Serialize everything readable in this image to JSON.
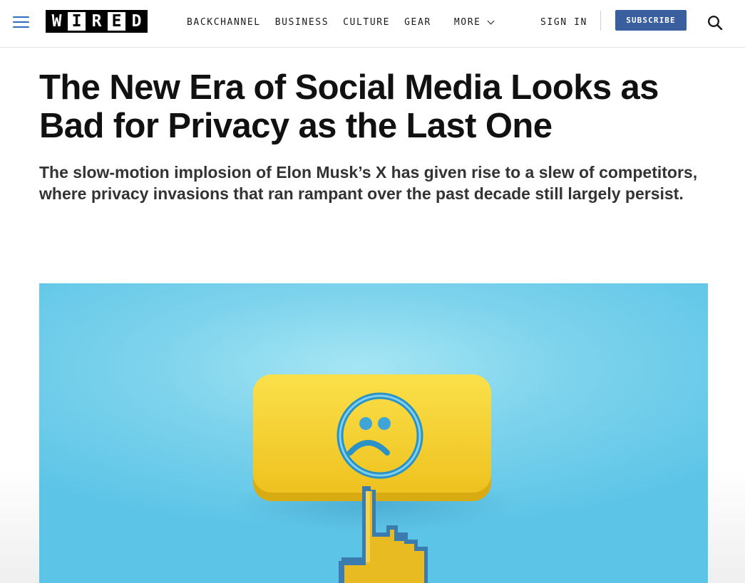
{
  "header": {
    "logo_letters": [
      "W",
      "I",
      "R",
      "E",
      "D"
    ],
    "nav": [
      {
        "label": "BACKCHANNEL"
      },
      {
        "label": "BUSINESS"
      },
      {
        "label": "CULTURE"
      },
      {
        "label": "GEAR"
      }
    ],
    "more_label": "MORE",
    "sign_in_label": "SIGN IN",
    "subscribe_label": "SUBSCRIBE",
    "icons": {
      "menu": "hamburger-menu-icon",
      "more": "chevron-down-icon",
      "search": "search-icon"
    }
  },
  "article": {
    "headline": "The New Era of Social Media Looks as Bad for Privacy as the Last One",
    "dek": "The slow-motion implosion of Elon Musk’s X has given rise to a slew of competitors, where privacy invasions that ran rampant over the past decade still largely persist."
  },
  "colors": {
    "accent_blue": "#2f6bbf",
    "subscribe_bg": "#3a5f9e",
    "hero_bg": "#6ccbe9",
    "hero_button": "#f4cf2a"
  }
}
